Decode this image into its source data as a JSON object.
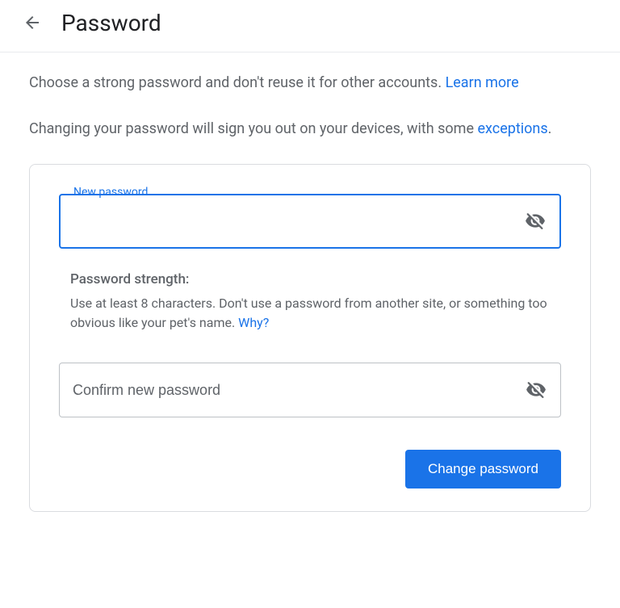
{
  "header": {
    "title": "Password"
  },
  "intro": {
    "line1_text": "Choose a strong password and don't reuse it for other accounts. ",
    "line1_link": "Learn more",
    "line2_text": "Changing your password will sign you out on your devices, with some ",
    "line2_link": "exceptions",
    "line2_suffix": "."
  },
  "form": {
    "new_password": {
      "label": "New password",
      "value": ""
    },
    "strength": {
      "title": "Password strength:",
      "desc_text": "Use at least 8 characters. Don't use a password from another site, or something too obvious like your pet's name. ",
      "desc_link": "Why?"
    },
    "confirm_password": {
      "placeholder": "Confirm new password",
      "value": ""
    },
    "submit_label": "Change password"
  }
}
